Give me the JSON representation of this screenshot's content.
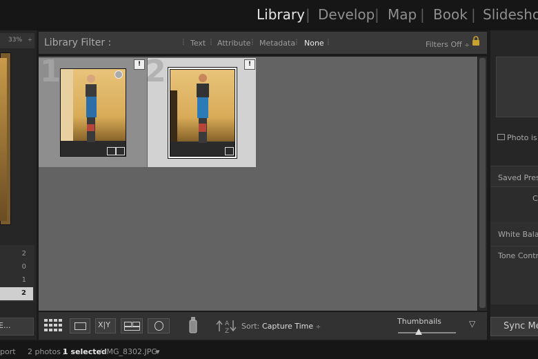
{
  "modules": {
    "library": "Library",
    "develop": "Develop",
    "map": "Map",
    "book": "Book",
    "slideshow": "Slideshow",
    "separator": "|"
  },
  "navigator": {
    "zoom": "33%",
    "zoom_arrow": "÷"
  },
  "collections": {
    "counts": [
      "2",
      "0",
      "1",
      "2"
    ]
  },
  "left_button": "E...",
  "filter_bar": {
    "title": "Library Filter :",
    "options": [
      "Text",
      "Attribute",
      "Metadata",
      "None"
    ],
    "active": "None",
    "filters_state": "Filters Off",
    "filters_arrow": "÷"
  },
  "grid": {
    "cells": [
      {
        "index": "1",
        "badge": "!"
      },
      {
        "index": "2",
        "badge": "!"
      }
    ]
  },
  "toolbar": {
    "sort_label": "Sort:",
    "sort_value": "Capture Time",
    "sort_arrow": "÷",
    "thumbnails_label": "Thumbnails",
    "thumbnails_size": 0.36,
    "menu_arrow": "▽"
  },
  "right_panel": {
    "histogram_info": "Photo is n",
    "rows": [
      "Saved Preset",
      "C",
      "White Balanc",
      "Tone Control"
    ],
    "sync_button": "Sync Me"
  },
  "statusbar": {
    "left": "port",
    "photos": "2 photos /",
    "selected": "1 selected",
    "file": "/ IMG_8302.JPG",
    "arrow": "▾"
  }
}
